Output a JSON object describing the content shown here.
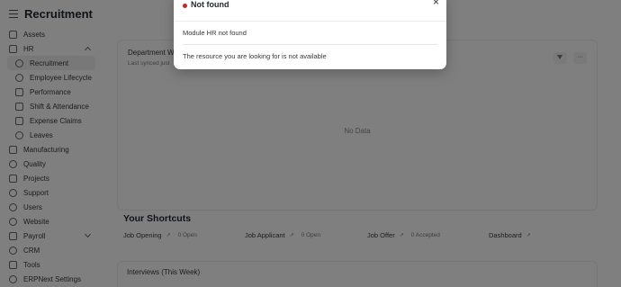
{
  "app": {
    "page_title": "Recruitment"
  },
  "sidebar": {
    "items": [
      {
        "label": "Assets",
        "icon": "asset-icon"
      },
      {
        "label": "HR",
        "icon": "hr-icon"
      },
      {
        "label": "Recruitment",
        "icon": "users-icon"
      },
      {
        "label": "Employee Lifecycle",
        "icon": "user-icon"
      },
      {
        "label": "Performance",
        "icon": "chart-icon"
      },
      {
        "label": "Shift & Attendance",
        "icon": "clipboard-icon"
      },
      {
        "label": "Expense Claims",
        "icon": "wallet-icon"
      },
      {
        "label": "Leaves",
        "icon": "leaf-icon"
      },
      {
        "label": "Manufacturing",
        "icon": "factory-icon"
      },
      {
        "label": "Quality",
        "icon": "quality-icon"
      },
      {
        "label": "Projects",
        "icon": "folder-icon"
      },
      {
        "label": "Support",
        "icon": "headset-icon"
      },
      {
        "label": "Users",
        "icon": "users-icon"
      },
      {
        "label": "Website",
        "icon": "globe-icon"
      },
      {
        "label": "Payroll",
        "icon": "money-icon"
      },
      {
        "label": "CRM",
        "icon": "crm-icon"
      },
      {
        "label": "Tools",
        "icon": "tool-icon"
      },
      {
        "label": "ERPNext Settings",
        "icon": "settings-icon"
      }
    ]
  },
  "main": {
    "chart_card": {
      "title": "Department W",
      "subtitle": "Last synced just",
      "empty": "No Data"
    },
    "shortcuts": {
      "title": "Your Shortcuts",
      "items": [
        {
          "label": "Job Opening",
          "count": "0 Open"
        },
        {
          "label": "Job Applicant",
          "count": "0 Open"
        },
        {
          "label": "Job Offer",
          "count": "0 Accepted"
        },
        {
          "label": "Dashboard",
          "count": ""
        }
      ]
    },
    "bottom_card": {
      "title": "Interviews (This Week)"
    }
  },
  "modal": {
    "title": "Not found",
    "close": "×",
    "line1": "Module HR not found",
    "line2": "The resource you are looking for is not available",
    "dot_color": "#c62828"
  }
}
